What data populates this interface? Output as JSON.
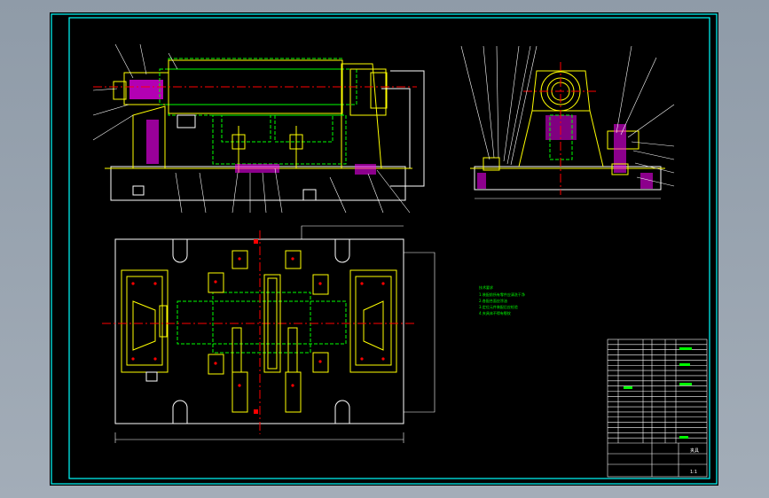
{
  "drawing": {
    "background": "#000000",
    "frame_color": "#00ffff",
    "line_colors": {
      "outline": "#ffff00",
      "hidden": "#00ff00",
      "center": "#ff0000",
      "leader": "#ffffff",
      "hatch": "#ff00ff",
      "dimension": "#ffffff"
    },
    "views": [
      "front-view",
      "side-view",
      "top-view"
    ]
  },
  "notes": {
    "title": "技术要求",
    "lines": [
      "1.装配前所有零件应清洗干净",
      "2.各配合面应涂油",
      "3.定位元件装配后应检验",
      "4.夹具体不得有裂纹"
    ]
  },
  "title_block": {
    "name": "夹具",
    "drawing_no": "",
    "scale": "1:1"
  }
}
